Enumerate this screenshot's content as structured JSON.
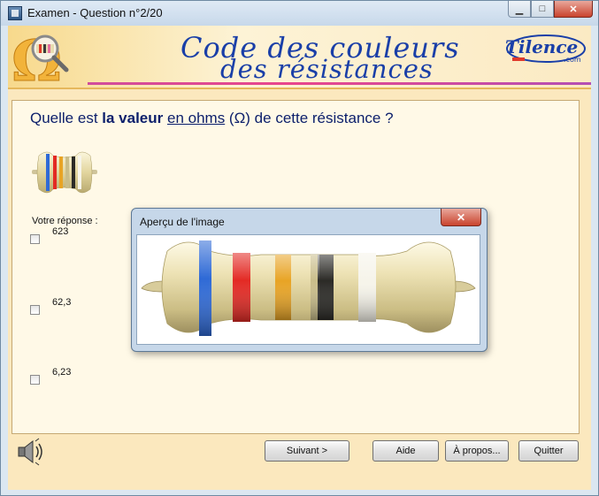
{
  "window": {
    "title": "Examen - Question n°2/20"
  },
  "banner": {
    "title_line1": "Code des couleurs",
    "title_line2": "des résistances",
    "logo_text": "Tilence",
    "logo_sub": ".com"
  },
  "question": {
    "part1": "Quelle est ",
    "bold": "la valeur",
    "part2": " ",
    "underlined": "en ohms",
    "part3": " (Ω) de cette résistance ?"
  },
  "answers": {
    "label": "Votre réponse :",
    "options": [
      "623",
      "62,3",
      "6,23"
    ]
  },
  "buttons": {
    "next": "Suivant >",
    "help": "Aide",
    "about": "À propos...",
    "quit": "Quitter"
  },
  "preview": {
    "title": "Aperçu de l'image",
    "close": "✕"
  },
  "resistor": {
    "body_color": "#e6dca8",
    "bands": [
      "#2f6ad6",
      "#e32a24",
      "#e8a425",
      "#c9bd8a",
      "#2b2a26",
      "#f6f4ea"
    ]
  },
  "icons": {
    "app": "app-icon",
    "omega_logo": "omega-magnifier-icon",
    "speaker": "speaker-icon"
  }
}
